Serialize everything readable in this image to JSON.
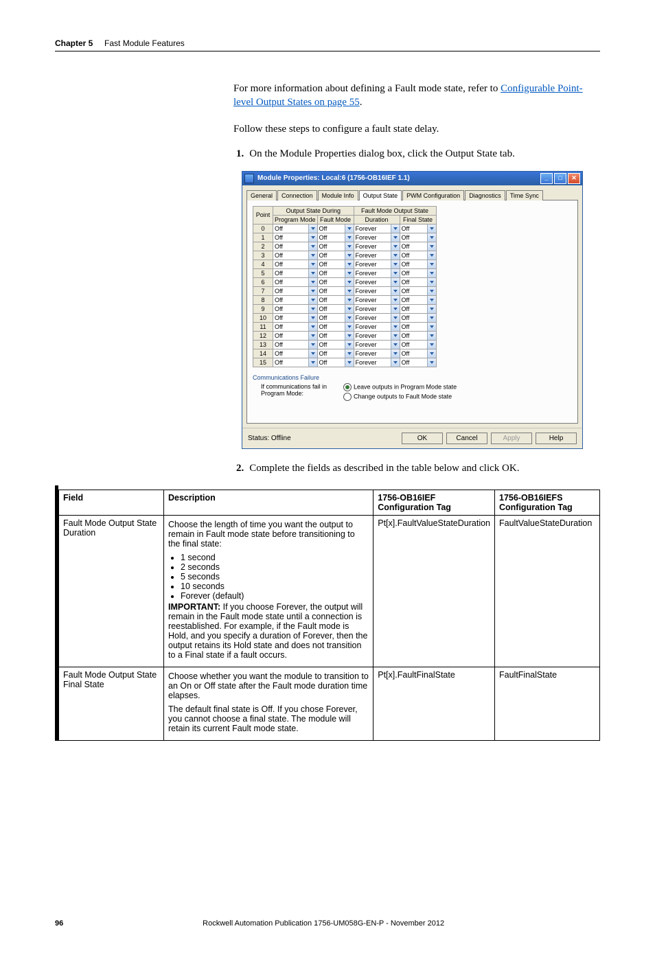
{
  "header": {
    "chapter": "Chapter 5",
    "title": "Fast Module Features"
  },
  "intro": {
    "p1a": "For more information about defining a Fault mode state, refer to ",
    "link1": "Configurable Point-level Output States on page 55",
    "p1b": ".",
    "p2": "Follow these steps to configure a fault state delay."
  },
  "steps": {
    "s1_num": "1.",
    "s1_text": "On the Module Properties dialog box, click the Output State tab.",
    "s2_num": "2.",
    "s2_text": "Complete the fields as described in the table below and click OK."
  },
  "dialog": {
    "title": "Module Properties: Local:6 (1756-OB16IEF 1.1)",
    "tabs": [
      "General",
      "Connection",
      "Module Info",
      "Output State",
      "PWM Configuration",
      "Diagnostics",
      "Time Sync"
    ],
    "group1": "Output State During",
    "group2": "Fault Mode Output State",
    "cols": [
      "Point",
      "Program Mode",
      "Fault Mode",
      "Duration",
      "Final State"
    ],
    "rows_count": 16,
    "cell_prog": "Off",
    "cell_fault": "Off",
    "cell_dur": "Forever",
    "cell_final": "Off",
    "comm_group": "Communications Failure",
    "comm_text": "If communications fail in Program Mode:",
    "radio1": "Leave outputs in Program Mode state",
    "radio2": "Change outputs to Fault Mode state",
    "status": "Status:  Offline",
    "btn_ok": "OK",
    "btn_cancel": "Cancel",
    "btn_apply": "Apply",
    "btn_help": "Help"
  },
  "table": {
    "headers": [
      "Field",
      "Description",
      "1756-OB16IEF Configuration Tag",
      "1756-OB16IEFS Configuration Tag"
    ],
    "r1": {
      "field": "Fault Mode Output State Duration",
      "desc_intro": "Choose the length of time you want the output to remain in Fault mode state before transitioning to the final state:",
      "bullets": [
        "1 second",
        "2 seconds",
        "5 seconds",
        "10 seconds",
        "Forever (default)"
      ],
      "imp_label": "IMPORTANT:",
      "imp_text": " If you choose Forever, the output will remain in the Fault mode state until a connection is reestablished. For example, if the Fault mode is Hold, and you specify a duration of Forever, then the output retains its Hold state and does not transition to a Final state if a fault occurs.",
      "tag1": "Pt[x].FaultValueStateDuration",
      "tag2": "FaultValueStateDuration"
    },
    "r2": {
      "field": "Fault Mode Output State Final State",
      "desc_p1": "Choose whether you want the module to transition to an On or Off state after the Fault mode duration time elapses.",
      "desc_p2": "The default final state is Off. If you chose Forever, you cannot choose a final state. The module will retain its current Fault mode state.",
      "tag1": "Pt[x].FaultFinalState",
      "tag2": "FaultFinalState"
    }
  },
  "footer": {
    "page": "96",
    "pub": "Rockwell Automation Publication 1756-UM058G-EN-P - November 2012"
  }
}
